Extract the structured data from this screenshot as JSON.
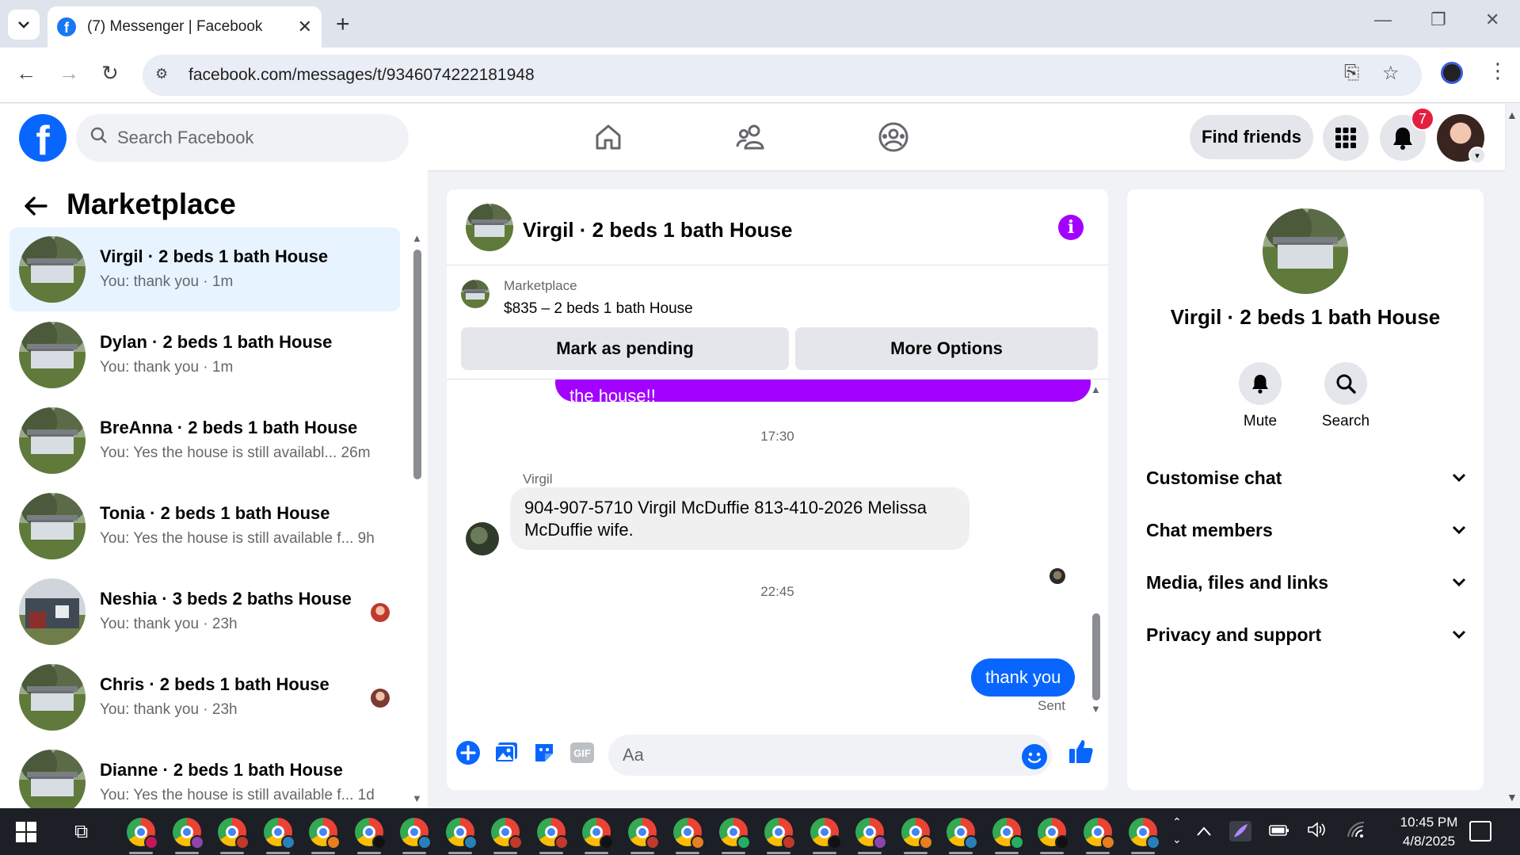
{
  "browser": {
    "tab_title": "(7) Messenger | Facebook",
    "url": "facebook.com/messages/t/9346074222181948"
  },
  "header": {
    "search_placeholder": "Search Facebook",
    "find_friends": "Find friends",
    "notification_count": "7"
  },
  "left_panel": {
    "title": "Marketplace",
    "conversations": [
      {
        "name": "Virgil · 2 beds 1 bath House",
        "preview": "You: thank you · 1m",
        "active": true,
        "seen_color": ""
      },
      {
        "name": "Dylan · 2 beds 1 bath House",
        "preview": "You: thank you · 1m",
        "active": false,
        "seen_color": ""
      },
      {
        "name": "BreAnna · 2 beds 1 bath House",
        "preview": "You: Yes the house is still availabl...   26m",
        "active": false,
        "seen_color": ""
      },
      {
        "name": "Tonia · 2 beds 1 bath House",
        "preview": "You: Yes the house is still available f...   9h",
        "active": false,
        "seen_color": ""
      },
      {
        "name": "Neshia · 3 beds 2 baths House",
        "preview": "You: thank you · 23h",
        "active": false,
        "seen_color": "#c0392b"
      },
      {
        "name": "Chris · 2 beds 1 bath House",
        "preview": "You: thank you · 23h",
        "active": false,
        "seen_color": "#7b3b35"
      },
      {
        "name": "Dianne · 2 beds 1 bath House",
        "preview": "You: Yes the house is still available f...   1d",
        "active": false,
        "seen_color": ""
      }
    ]
  },
  "conversation": {
    "title": "Virgil · 2 beds 1 bath House",
    "marketplace_label": "Marketplace",
    "listing": "$835 – 2 beds 1 bath House",
    "mark_pending": "Mark as pending",
    "more_options": "More Options",
    "partial_message": "the house!!",
    "time_1": "17:30",
    "sender": "Virgil",
    "received_message": "904-907-5710 Virgil McDuffie 813-410-2026 Melissa McDuffie wife.",
    "time_2": "22:45",
    "sent_message": "thank you",
    "sent_status": "Sent",
    "composer_placeholder": "Aa",
    "gif_label": "GIF"
  },
  "right_panel": {
    "title": "Virgil · 2 beds 1 bath House",
    "mute": "Mute",
    "search": "Search",
    "sections": [
      "Customise chat",
      "Chat members",
      "Media, files and links",
      "Privacy and support"
    ]
  },
  "taskbar": {
    "time": "10:45 PM",
    "date": "4/8/2025",
    "profile_badges": [
      "#c2185b",
      "#8e44ad",
      "#c0392b",
      "#2980b9",
      "#e67e22",
      "#111111",
      "#2980b9",
      "#2980b9",
      "#c0392b",
      "#c0392b",
      "#111111",
      "#c0392b",
      "#e67e22",
      "#27ae60",
      "#c0392b",
      "#111111",
      "#8e44ad",
      "#e67e22",
      "#2980b9",
      "#27ae60",
      "#111111",
      "#e67e22",
      "#2980b9"
    ]
  },
  "colors": {
    "facebook_blue": "#0866ff",
    "marketplace_purple": "#a200ff",
    "active_conversation": "#e7f3ff"
  }
}
